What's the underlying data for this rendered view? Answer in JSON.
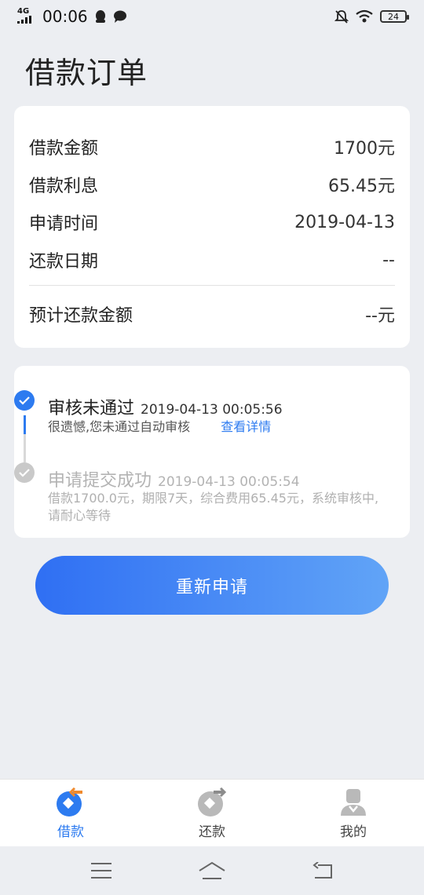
{
  "status_bar": {
    "network": "4G",
    "time": "00:06",
    "battery": "24"
  },
  "page": {
    "title": "借款订单"
  },
  "order_info": {
    "rows": [
      {
        "label": "借款金额",
        "value": "1700元"
      },
      {
        "label": "借款利息",
        "value": "65.45元"
      },
      {
        "label": "申请时间",
        "value": "2019-04-13"
      },
      {
        "label": "还款日期",
        "value": "--"
      }
    ],
    "total": {
      "label": "预计还款金额",
      "value": "--元"
    }
  },
  "timeline": [
    {
      "title": "审核未通过",
      "time": "2019-04-13 00:05:56",
      "desc": "很遗憾,您未通过自动审核",
      "link": "查看详情",
      "state": "active"
    },
    {
      "title": "申请提交成功",
      "time": "2019-04-13 00:05:54",
      "desc": "借款1700.0元，期限7天，综合费用65.45元，系统审核中,请耐心等待",
      "state": "inactive"
    }
  ],
  "actions": {
    "reapply_label": "重新申请"
  },
  "tabbar": {
    "items": [
      {
        "label": "借款",
        "icon": "loan-icon",
        "active": true
      },
      {
        "label": "还款",
        "icon": "repay-icon",
        "active": false
      },
      {
        "label": "我的",
        "icon": "profile-icon",
        "active": false
      }
    ]
  },
  "colors": {
    "accent": "#2d7bf0",
    "button_gradient_start": "#2f6ff3",
    "button_gradient_end": "#61a4f7",
    "background": "#eceef2"
  }
}
